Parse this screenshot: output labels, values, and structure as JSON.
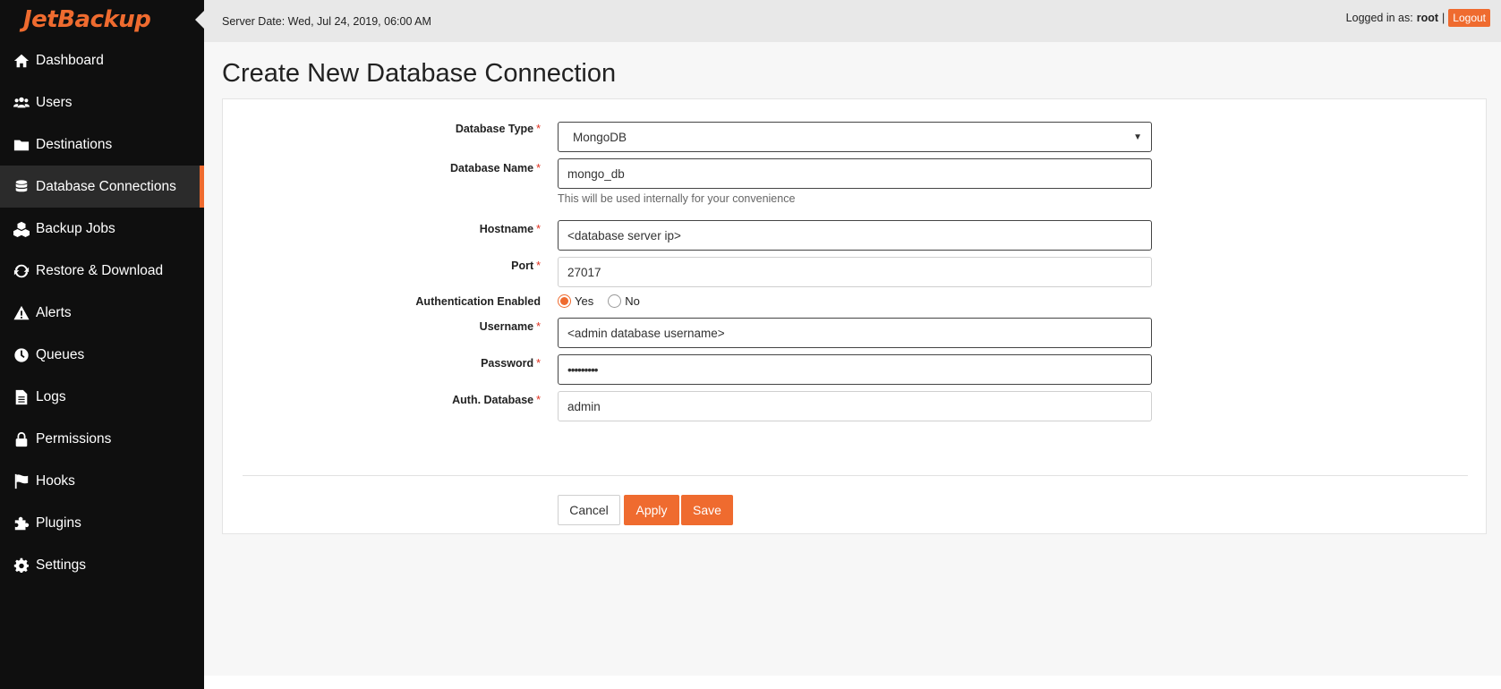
{
  "app": {
    "logo": "JetBackup"
  },
  "sidebar": {
    "items": [
      {
        "label": "Dashboard",
        "icon": "home-icon",
        "active": false
      },
      {
        "label": "Users",
        "icon": "users-icon",
        "active": false
      },
      {
        "label": "Destinations",
        "icon": "folder-icon",
        "active": false
      },
      {
        "label": "Database Connections",
        "icon": "database-icon",
        "active": true
      },
      {
        "label": "Backup Jobs",
        "icon": "cubes-icon",
        "active": false
      },
      {
        "label": "Restore & Download",
        "icon": "refresh-icon",
        "active": false
      },
      {
        "label": "Alerts",
        "icon": "warning-icon",
        "active": false
      },
      {
        "label": "Queues",
        "icon": "clock-icon",
        "active": false
      },
      {
        "label": "Logs",
        "icon": "file-icon",
        "active": false
      },
      {
        "label": "Permissions",
        "icon": "lock-icon",
        "active": false
      },
      {
        "label": "Hooks",
        "icon": "flag-icon",
        "active": false
      },
      {
        "label": "Plugins",
        "icon": "puzzle-icon",
        "active": false
      },
      {
        "label": "Settings",
        "icon": "gear-icon",
        "active": false
      }
    ]
  },
  "header": {
    "server_date": "Server Date: Wed, Jul 24, 2019, 06:00 AM",
    "logged_in_prefix": "Logged in as:",
    "username": "root",
    "separator": "|",
    "logout_label": "Logout"
  },
  "page": {
    "title": "Create New Database Connection"
  },
  "form": {
    "database_type": {
      "label": "Database Type",
      "value": "MongoDB"
    },
    "database_name": {
      "label": "Database Name",
      "value": "mongo_db",
      "hint": "This will be used internally for your convenience"
    },
    "hostname": {
      "label": "Hostname",
      "value": "<database server ip>"
    },
    "port": {
      "label": "Port",
      "value": "27017"
    },
    "auth_enabled": {
      "label": "Authentication Enabled",
      "yes_label": "Yes",
      "no_label": "No",
      "selected": "Yes"
    },
    "username": {
      "label": "Username",
      "value": "<admin database username>"
    },
    "password": {
      "label": "Password",
      "value": "•••••••••"
    },
    "auth_database": {
      "label": "Auth. Database",
      "value": "admin"
    },
    "required_marker": "*"
  },
  "actions": {
    "cancel_label": "Cancel",
    "apply_label": "Apply",
    "save_label": "Save"
  },
  "colors": {
    "accent": "#ef6b2f",
    "sidebar_bg": "#0f0f0f",
    "topbar_bg": "#e8e8e8"
  }
}
